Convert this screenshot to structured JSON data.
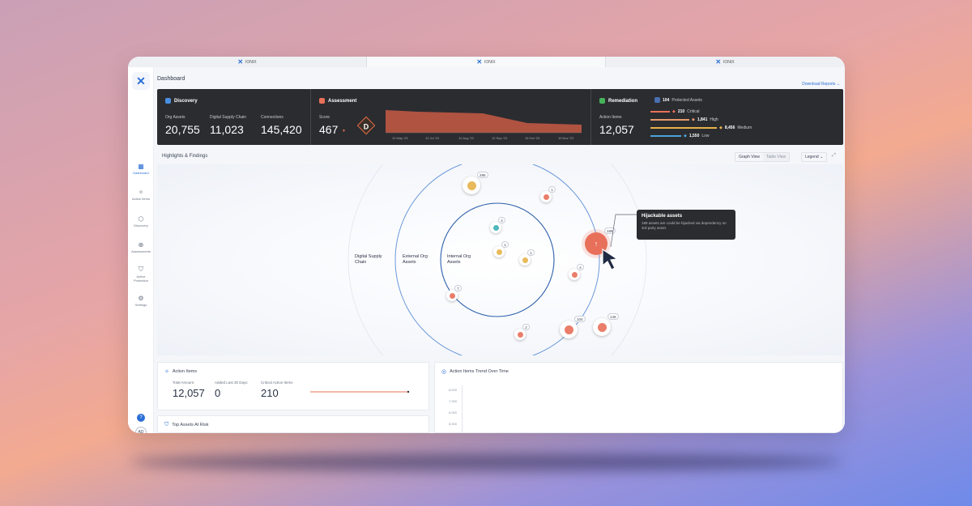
{
  "tabs": [
    "IONIX",
    "IONIX",
    "IONIX"
  ],
  "sidebar": {
    "logo": "✕",
    "items": [
      {
        "label": "Dashboard",
        "icon": "grid-icon"
      },
      {
        "label": "Action Items",
        "icon": "sparkle-icon"
      },
      {
        "label": "Discovery",
        "icon": "cube-icon"
      },
      {
        "label": "Assessments",
        "icon": "magnifier-icon"
      },
      {
        "label": "Active Protection",
        "icon": "shield-icon"
      },
      {
        "label": "Settings",
        "icon": "gear-icon"
      }
    ],
    "help": "?",
    "avatar": "AD"
  },
  "header": {
    "title": "Dashboard",
    "download": "Download Reports ⌄"
  },
  "discovery": {
    "title": "Discovery",
    "metrics": [
      {
        "label": "Org Assets",
        "value": "20,755"
      },
      {
        "label": "Digital Supply Chain",
        "value": "11,023"
      },
      {
        "label": "Connections",
        "value": "145,420"
      }
    ]
  },
  "assessment": {
    "title": "Assessment",
    "score_label": "Score",
    "score": "467",
    "grade": "D",
    "ticks": [
      "12 May '23",
      "12 Jul '23",
      "12 Aug '23",
      "12 Sep '23",
      "15 Oct '23",
      "10 Nov '23"
    ]
  },
  "remediation": {
    "title": "Remediation",
    "action_label": "Action Items",
    "action_value": "12,057",
    "protected_count": "104",
    "protected_label": "Protected Assets",
    "levels": [
      {
        "count": "210",
        "label": "Critical",
        "color": "#e8705a"
      },
      {
        "count": "1,841",
        "label": "High",
        "color": "#e79a6a"
      },
      {
        "count": "8,456",
        "label": "Medium",
        "color": "#e6b24a"
      },
      {
        "count": "1,550",
        "label": "Low",
        "color": "#4aa3d8"
      }
    ]
  },
  "highlights": {
    "title": "Highlights & Findings",
    "graph_view": "Graph View",
    "table_view": "Table View",
    "legend": "Legend ⌄",
    "rings": [
      {
        "label": "Digital Supply\nChain"
      },
      {
        "label": "External Org\nAssets"
      },
      {
        "label": "Internal Org\nAssets"
      }
    ],
    "nodes": [
      {
        "count": "285",
        "color": "#e6b24a"
      },
      {
        "count": "1",
        "color": "#e8705a"
      },
      {
        "count": "4",
        "color": "#3bb0b3"
      },
      {
        "count": "1",
        "color": "#e6b24a"
      },
      {
        "count": "1",
        "color": "#e6b24a"
      },
      {
        "count": "7",
        "color": "#e8705a"
      },
      {
        "count": "4",
        "color": "#e8705a"
      },
      {
        "count": "2",
        "color": "#e8705a"
      },
      {
        "count": "104",
        "color": "#e8705a"
      },
      {
        "count": "145",
        "color": "#e8705a"
      },
      {
        "count": "189",
        "color": "#e8705a"
      }
    ],
    "tooltip": {
      "title": "Hijackable assets",
      "desc": "189 assets are could be hijacked via dependency on 3rd party asset."
    }
  },
  "action_items": {
    "title": "Action Items",
    "metrics": [
      {
        "label": "Total Amount",
        "value": "12,057"
      },
      {
        "label": "Added Last 30 Days",
        "value": "0"
      },
      {
        "label": "Critical Action Items",
        "value": "210"
      }
    ]
  },
  "trend": {
    "title": "Action Items Trend Over Time",
    "ylabels": [
      "8,000",
      "7,000",
      "6,000",
      "5,000"
    ]
  },
  "top_assets": {
    "title": "Top Assets At Risk"
  }
}
